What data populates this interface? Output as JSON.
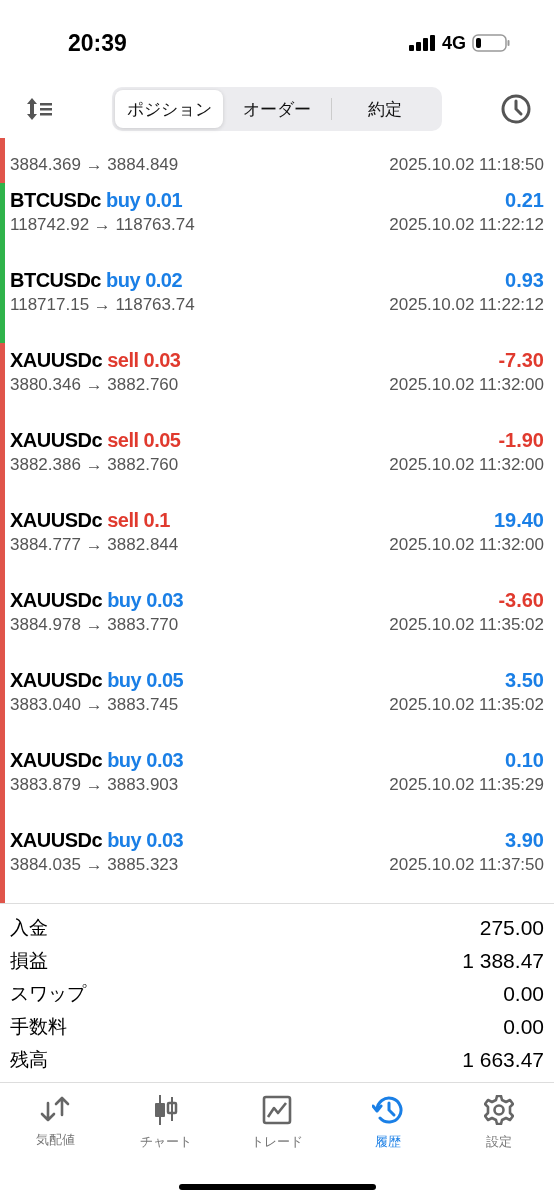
{
  "status_bar": {
    "time": "20:39",
    "network": "4G"
  },
  "tabs": [
    {
      "label": "ポジション",
      "selected": true
    },
    {
      "label": "オーダー",
      "selected": false
    },
    {
      "label": "約定",
      "selected": false
    }
  ],
  "partial_row": {
    "prices": "3884.369 → 3884.849",
    "time": "2025.10.02 11:18:50",
    "color": "#e0554a"
  },
  "trades": [
    {
      "symbol": "BTCUSDc",
      "type": "buy",
      "volume": "0.01",
      "profit": "0.21",
      "loss": false,
      "prices": "118742.92 → 118763.74",
      "time": "2025.10.02 11:22:12",
      "color": "#2fb34a"
    },
    {
      "symbol": "BTCUSDc",
      "type": "buy",
      "volume": "0.02",
      "profit": "0.93",
      "loss": false,
      "prices": "118717.15 → 118763.74",
      "time": "2025.10.02 11:22:12",
      "color": "#2fb34a"
    },
    {
      "symbol": "XAUUSDc",
      "type": "sell",
      "volume": "0.03",
      "profit": "-7.30",
      "loss": true,
      "prices": "3880.346 → 3882.760",
      "time": "2025.10.02 11:32:00",
      "color": "#e0554a"
    },
    {
      "symbol": "XAUUSDc",
      "type": "sell",
      "volume": "0.05",
      "profit": "-1.90",
      "loss": true,
      "prices": "3882.386 → 3882.760",
      "time": "2025.10.02 11:32:00",
      "color": "#e0554a"
    },
    {
      "symbol": "XAUUSDc",
      "type": "sell",
      "volume": "0.1",
      "profit": "19.40",
      "loss": false,
      "prices": "3884.777 → 3882.844",
      "time": "2025.10.02 11:32:00",
      "color": "#e0554a"
    },
    {
      "symbol": "XAUUSDc",
      "type": "buy",
      "volume": "0.03",
      "profit": "-3.60",
      "loss": true,
      "prices": "3884.978 → 3883.770",
      "time": "2025.10.02 11:35:02",
      "color": "#e0554a"
    },
    {
      "symbol": "XAUUSDc",
      "type": "buy",
      "volume": "0.05",
      "profit": "3.50",
      "loss": false,
      "prices": "3883.040 → 3883.745",
      "time": "2025.10.02 11:35:02",
      "color": "#e0554a"
    },
    {
      "symbol": "XAUUSDc",
      "type": "buy",
      "volume": "0.03",
      "profit": "0.10",
      "loss": false,
      "prices": "3883.879 → 3883.903",
      "time": "2025.10.02 11:35:29",
      "color": "#e0554a"
    },
    {
      "symbol": "XAUUSDc",
      "type": "buy",
      "volume": "0.03",
      "profit": "3.90",
      "loss": false,
      "prices": "3884.035 → 3885.323",
      "time": "2025.10.02 11:37:50",
      "color": "#e0554a"
    }
  ],
  "summary": [
    {
      "label": "入金",
      "value": "275.00"
    },
    {
      "label": "損益",
      "value": "1 388.47"
    },
    {
      "label": "スワップ",
      "value": "0.00"
    },
    {
      "label": "手数料",
      "value": "0.00"
    },
    {
      "label": "残高",
      "value": "1 663.47"
    }
  ],
  "nav": [
    {
      "kind": "quotes",
      "label": "気配値",
      "selected": false
    },
    {
      "kind": "chart",
      "label": "チャート",
      "selected": false
    },
    {
      "kind": "trade",
      "label": "トレード",
      "selected": false
    },
    {
      "kind": "history",
      "label": "履歴",
      "selected": true
    },
    {
      "kind": "settings",
      "label": "設定",
      "selected": false
    }
  ]
}
